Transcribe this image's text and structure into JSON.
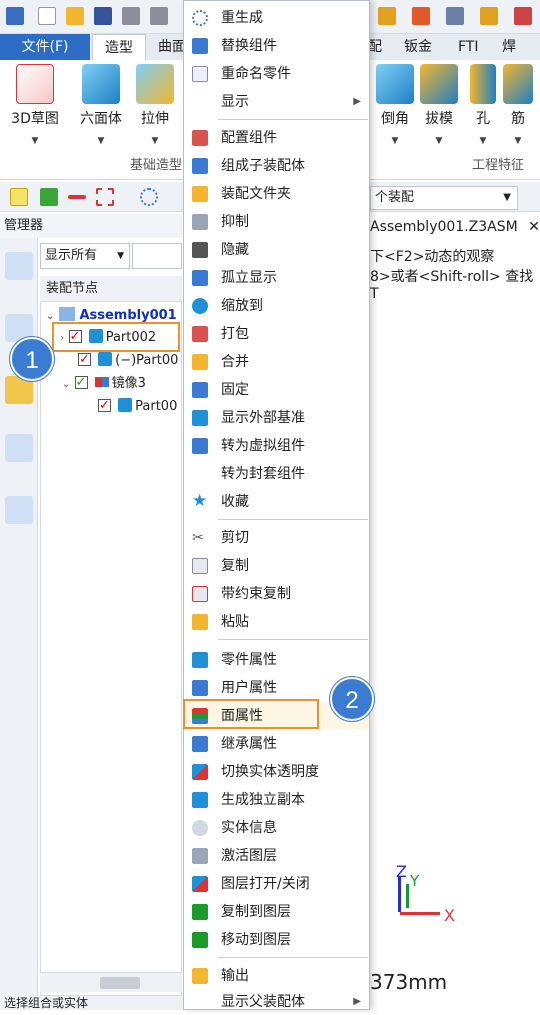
{
  "window": {
    "doc_tab": "Assembly001.Z3ASM",
    "close_glyph": "✕"
  },
  "ribbon": {
    "tabs": [
      {
        "label": "文件(F)"
      },
      {
        "label": "造型"
      },
      {
        "label": "曲面"
      },
      {
        "label": "钣金"
      },
      {
        "label": "FTI"
      },
      {
        "label": "焊件"
      }
    ],
    "partial_tab_label": "配",
    "buttons": [
      {
        "label": "3D草图"
      },
      {
        "label": "六面体"
      },
      {
        "label": "拉伸"
      },
      {
        "label": "倒角"
      },
      {
        "label": "拔模"
      },
      {
        "label": "孔"
      },
      {
        "label": "筋"
      }
    ],
    "groups": [
      "基础造型",
      "工程特征"
    ]
  },
  "toolbar2": {
    "assembly_select": "个装配"
  },
  "manager": {
    "title": "管理器",
    "filter": "显示所有",
    "tree_header": "装配节点",
    "nodes": [
      {
        "label": "Assembly001"
      },
      {
        "label": "Part002"
      },
      {
        "label": "(−)Part00"
      },
      {
        "label": "镜像3"
      },
      {
        "label": "Part00"
      }
    ]
  },
  "viewport": {
    "hint1": "下<F2>动态的观察",
    "hint2": "8>或者<Shift-roll> 查找T",
    "measure": "373mm",
    "axes": {
      "x": "X",
      "y": "Y",
      "z": "Z"
    }
  },
  "context_menu": {
    "items": [
      {
        "label": "重生成"
      },
      {
        "label": "替换组件"
      },
      {
        "label": "重命名零件"
      },
      {
        "label": "显示",
        "submenu": true
      },
      {
        "label": "配置组件"
      },
      {
        "label": "组成子装配体"
      },
      {
        "label": "装配文件夹"
      },
      {
        "label": "抑制"
      },
      {
        "label": "隐藏"
      },
      {
        "label": "孤立显示"
      },
      {
        "label": "缩放到"
      },
      {
        "label": "打包"
      },
      {
        "label": "合并"
      },
      {
        "label": "固定"
      },
      {
        "label": "显示外部基准"
      },
      {
        "label": "转为虚拟组件"
      },
      {
        "label": "转为封套组件"
      },
      {
        "label": "收藏"
      },
      {
        "label": "剪切"
      },
      {
        "label": "复制"
      },
      {
        "label": "带约束复制"
      },
      {
        "label": "粘贴"
      },
      {
        "label": "零件属性"
      },
      {
        "label": "用户属性"
      },
      {
        "label": "面属性"
      },
      {
        "label": "继承属性"
      },
      {
        "label": "切换实体透明度"
      },
      {
        "label": "生成独立副本"
      },
      {
        "label": "实体信息"
      },
      {
        "label": "激活图层"
      },
      {
        "label": "图层打开/关闭"
      },
      {
        "label": "复制到图层"
      },
      {
        "label": "移动到图层"
      },
      {
        "label": "输出"
      },
      {
        "label": "显示父装配体",
        "submenu": true
      }
    ],
    "submenu_arrow": "▶"
  },
  "steps": [
    "1",
    "2"
  ],
  "status": {
    "text": "选择组合或实体"
  },
  "colors": {
    "accent": "#2c6cc4",
    "highlight": "#f0902a",
    "badge": "#3b7bd1"
  }
}
